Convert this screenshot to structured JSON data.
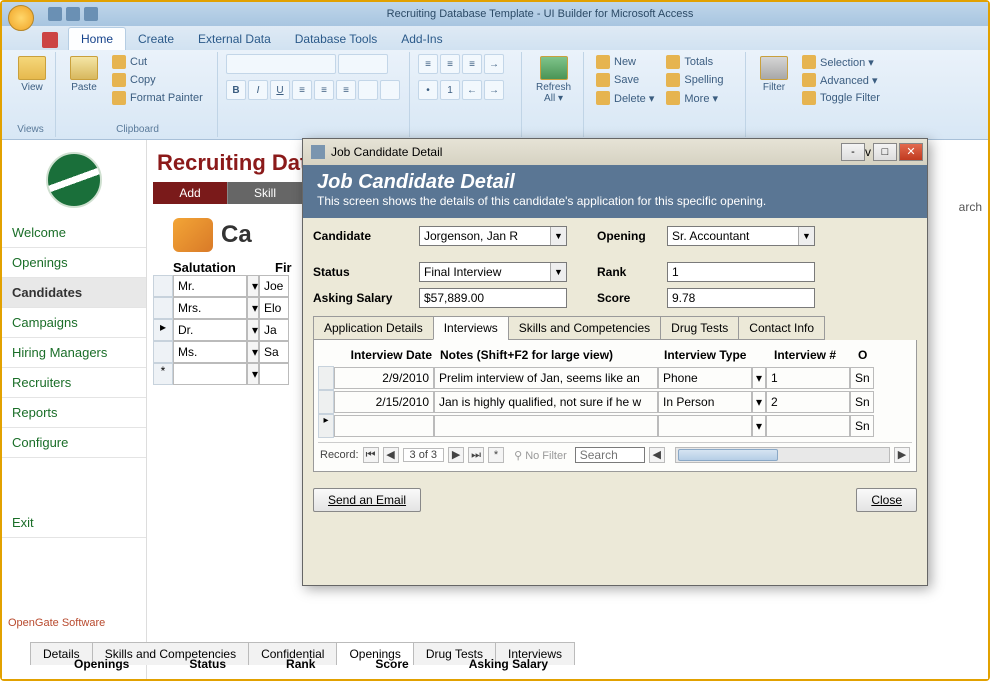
{
  "window": {
    "title": "Recruiting Database Template - UI Builder for Microsoft Access"
  },
  "ribbon_tabs": [
    "Home",
    "Create",
    "External Data",
    "Database Tools",
    "Add-Ins"
  ],
  "ribbon": {
    "views": {
      "label": "Views",
      "view": "View"
    },
    "clipboard": {
      "label": "Clipboard",
      "paste": "Paste",
      "cut": "Cut",
      "copy": "Copy",
      "format_painter": "Format Painter"
    },
    "refresh": {
      "label": "Refresh All ▾"
    },
    "records": {
      "new": "New",
      "save": "Save",
      "delete": "Delete ▾",
      "totals": "Totals",
      "spelling": "Spelling",
      "more": "More ▾"
    },
    "filter": {
      "label": "Filter",
      "selection": "Selection ▾",
      "advanced": "Advanced ▾",
      "toggle": "Toggle Filter"
    }
  },
  "page": {
    "title": "Recruiting Databa"
  },
  "nav": {
    "items": [
      "Welcome",
      "Openings",
      "Candidates",
      "Campaigns",
      "Hiring Managers",
      "Recruiters",
      "Reports",
      "Configure"
    ],
    "exit": "Exit",
    "footer": "OpenGate Software"
  },
  "top_tabs": {
    "add": "Add",
    "skill": "Skill"
  },
  "cand_section": {
    "title": "Ca"
  },
  "grid": {
    "head": {
      "salutation": "Salutation",
      "first": "Fir"
    },
    "rows": [
      {
        "sal": "Mr.",
        "first": "Joe"
      },
      {
        "sal": "Mrs.",
        "first": "Elo"
      },
      {
        "sal": "Dr.",
        "first": "Ja"
      },
      {
        "sal": "Ms.",
        "first": "Sa"
      },
      {
        "sal": "",
        "first": ""
      }
    ]
  },
  "bottom_tabs": [
    "Details",
    "Skills and Competencies",
    "Confidential",
    "Openings",
    "Drug Tests",
    "Interviews"
  ],
  "bottom_head": [
    "Openings",
    "Status",
    "Rank",
    "Score",
    "Asking Salary"
  ],
  "modal": {
    "title": "Job Candidate Detail",
    "header": "Job Candidate Detail",
    "subheader": "This screen shows the details of this candidate's application for this specific opening.",
    "labels": {
      "candidate": "Candidate",
      "opening": "Opening",
      "status": "Status",
      "rank": "Rank",
      "asking": "Asking Salary",
      "score": "Score"
    },
    "values": {
      "candidate": "Jorgenson, Jan R",
      "opening": "Sr. Accountant",
      "status": "Final Interview",
      "rank": "1",
      "asking": "$57,889.00",
      "score": "9.78"
    },
    "subtabs": [
      "Application Details",
      "Interviews",
      "Skills and Competencies",
      "Drug Tests",
      "Contact Info"
    ],
    "subgrid": {
      "head": {
        "date": "Interview Date",
        "notes": "Notes (Shift+F2 for large view)",
        "type": "Interview Type",
        "num": "Interview #",
        "o": "O"
      },
      "rows": [
        {
          "date": "2/9/2010",
          "notes": "Prelim interview of Jan, seems like an",
          "type": "Phone",
          "num": "1",
          "o": "Sn"
        },
        {
          "date": "2/15/2010",
          "notes": "Jan is highly qualified, not sure if he w",
          "type": "In Person",
          "num": "2",
          "o": "Sn"
        },
        {
          "date": "",
          "notes": "",
          "type": "",
          "num": "",
          "o": "Sn"
        }
      ]
    },
    "recnav": {
      "label": "Record:",
      "pos": "3 of 3",
      "nofilter": "No Filter",
      "search": "Search"
    },
    "btn_email": "Send an Email",
    "btn_close": "Close"
  },
  "search_hint": "arch"
}
